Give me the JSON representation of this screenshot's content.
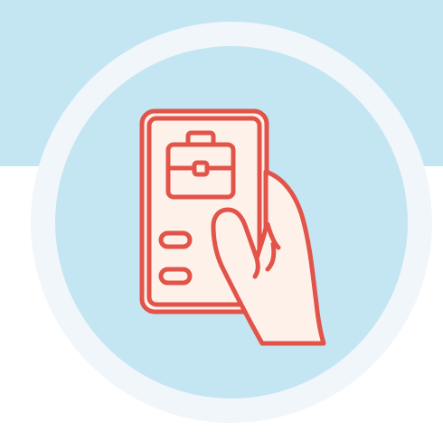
{
  "scene": {
    "icon": "mobile-job-app-hand-icon",
    "colors": {
      "band": "#c4e6f3",
      "circle_fill": "#c4e6f3",
      "circle_ring": "#f1f6fb",
      "stroke": "#e2534a",
      "phone_fill": "#fdf1ea",
      "hand_fill": "#fdf1ea",
      "page_bg": "#ffffff"
    }
  }
}
